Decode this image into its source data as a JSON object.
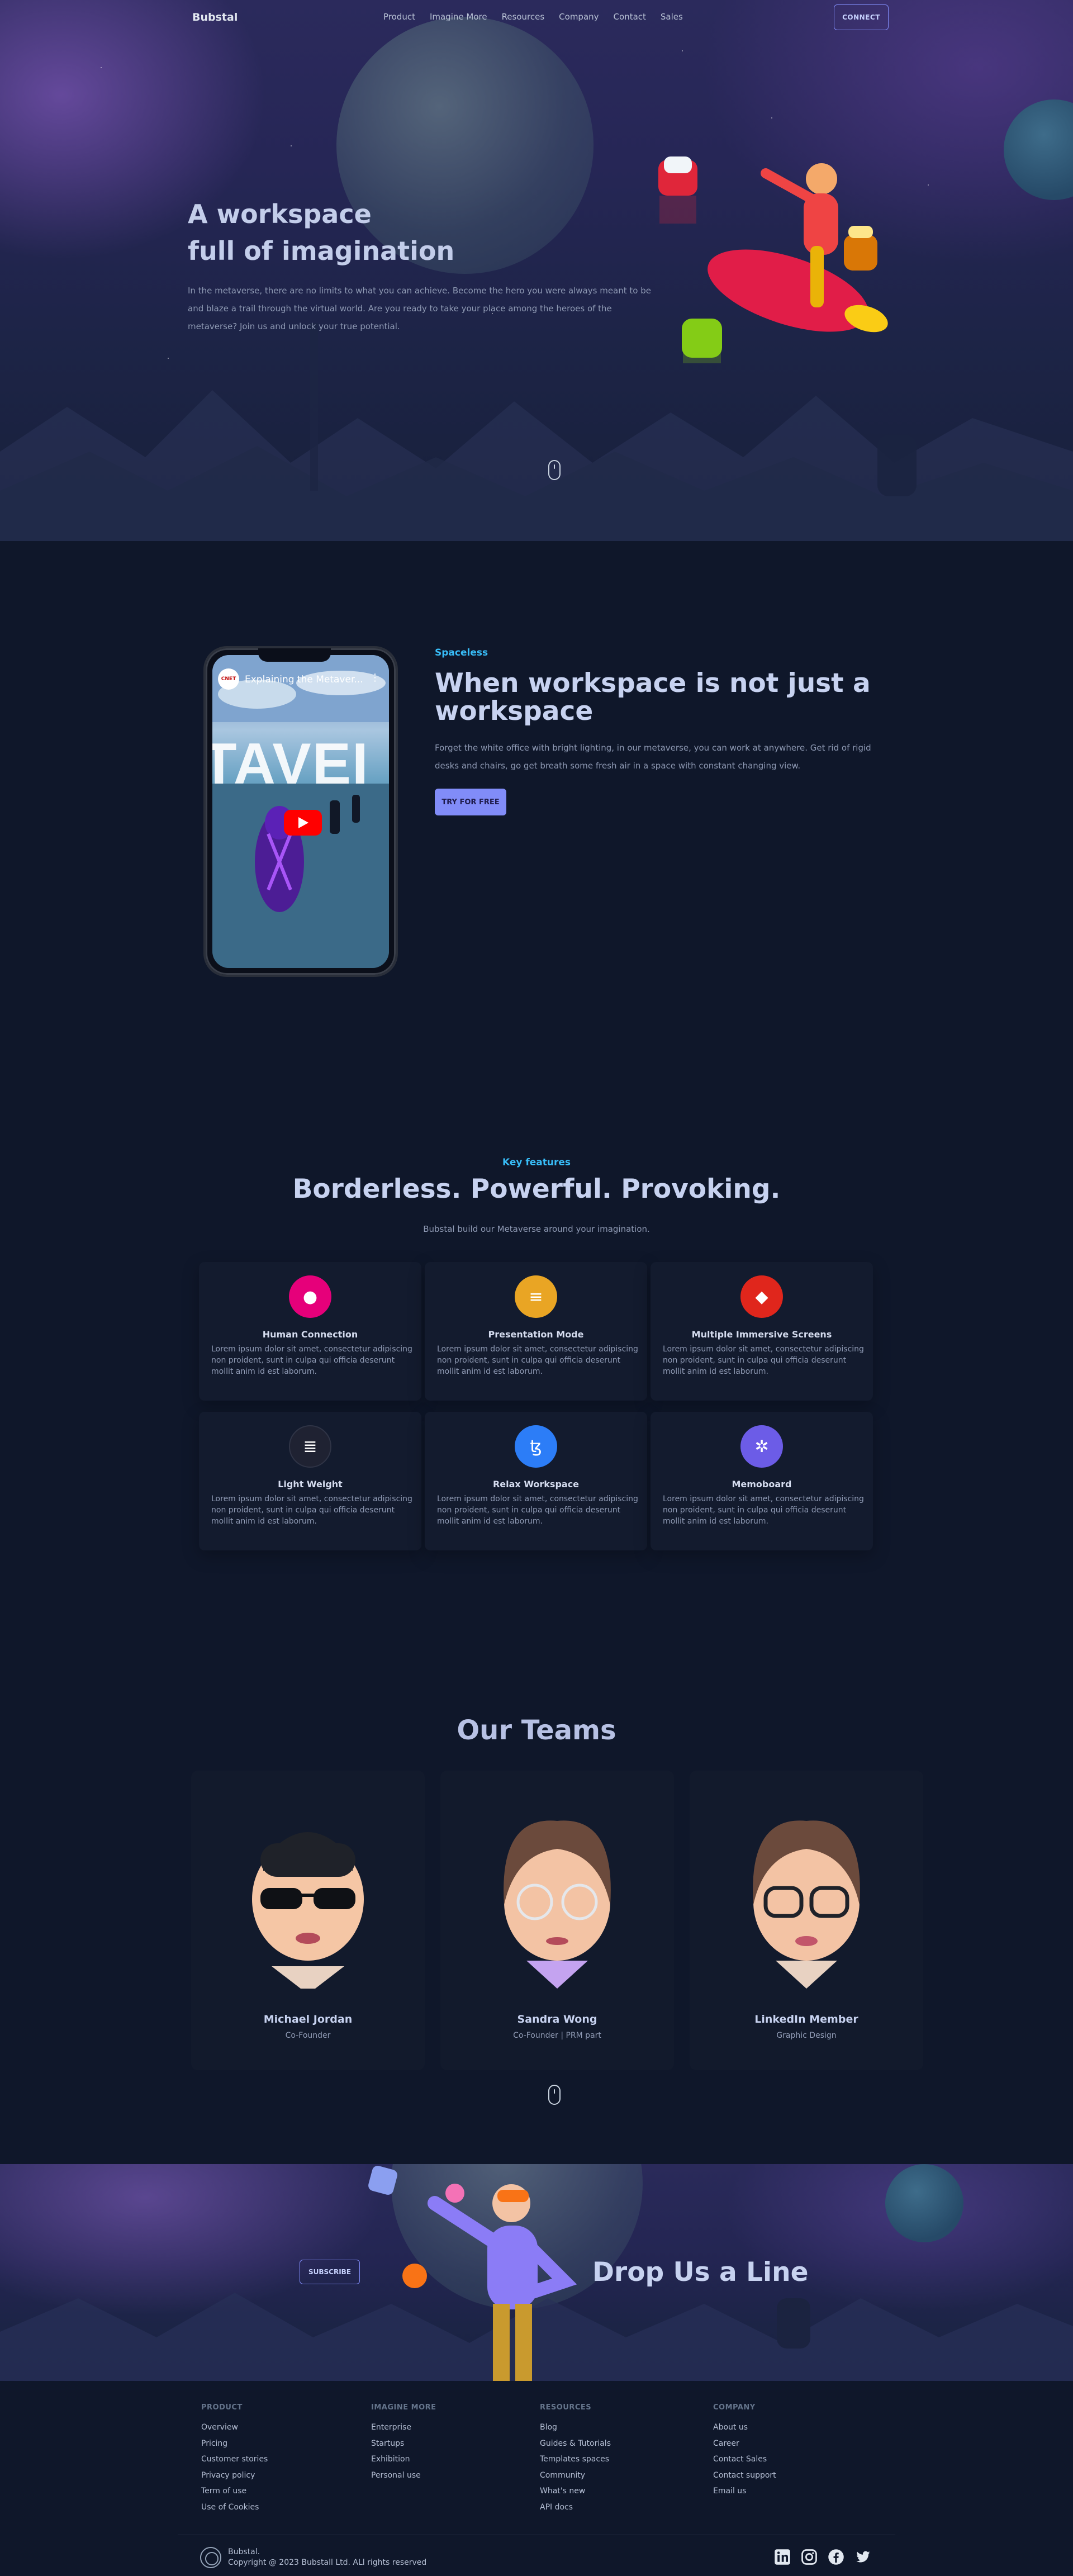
{
  "nav": {
    "brand": "Bubstal",
    "links": [
      "Product",
      "Imagine More",
      "Resources",
      "Company",
      "Contact",
      "Sales"
    ],
    "connect_label": "CONNECT"
  },
  "hero": {
    "title_line1": "A workspace",
    "title_line2": "full of imagination",
    "description": "In the metaverse, there are no limits to what you can achieve. Become the hero you were always meant to be and blaze a trail through the virtual world. Are you ready to take your place among the heroes of the metaverse? Join us and unlock your true potential."
  },
  "video": {
    "channel_logo": "CNET",
    "title": "Explaining the Metaver...",
    "overlay_text": "TAVEI"
  },
  "spaceless": {
    "eyebrow": "Spaceless",
    "title": "When workspace is not just a workspace",
    "description": "Forget the white office with bright lighting, in our metaverse, you can work at anywhere. Get rid of rigid desks and chairs, go get breath some fresh air in a space with constant changing view.",
    "cta_label": "TRY FOR FREE"
  },
  "features": {
    "eyebrow": "Key features",
    "title": "Borderless. Powerful. Provoking.",
    "subtitle": "Bubstal build our Metaverse around your imagination.",
    "items": [
      {
        "title": "Human Connection",
        "description": "Lorem ipsum dolor sit amet, consectetur adipiscing non proident, sunt in culpa qui officia deserunt mollit anim id est laborum.",
        "icon": "polkadot-icon",
        "color": "#e6007a",
        "glyph": "●"
      },
      {
        "title": "Presentation Mode",
        "description": "Lorem ipsum dolor sit amet, consectetur adipiscing non proident, sunt in culpa qui officia deserunt mollit anim id est laborum.",
        "icon": "stacks-icon",
        "color": "#e9a524",
        "glyph": "≡"
      },
      {
        "title": "Multiple Immersive Screens",
        "description": "Lorem ipsum dolor sit amet, consectetur adipiscing non proident, sunt in culpa qui officia deserunt mollit anim id est laborum.",
        "icon": "shiba-icon",
        "color": "#e0261c",
        "glyph": "◆"
      },
      {
        "title": "Light Weight",
        "description": "Lorem ipsum dolor sit amet, consectetur adipiscing non proident, sunt in culpa qui officia deserunt mollit anim id est laborum.",
        "icon": "solana-icon",
        "color": "#1f2232",
        "glyph": "≣"
      },
      {
        "title": "Relax Workspace",
        "description": "Lorem ipsum dolor sit amet, consectetur adipiscing non proident, sunt in culpa qui officia deserunt mollit anim id est laborum.",
        "icon": "tezos-icon",
        "color": "#2c7df7",
        "glyph": "ꜩ"
      },
      {
        "title": "Memoboard",
        "description": "Lorem ipsum dolor sit amet, consectetur adipiscing non proident, sunt in culpa qui officia deserunt mollit anim id est laborum.",
        "icon": "stellar-icon",
        "color": "#6c5ce7",
        "glyph": "✲"
      }
    ]
  },
  "teams": {
    "title": "Our Teams",
    "members": [
      {
        "name": "Michael Jordan",
        "role": "Co-Founder"
      },
      {
        "name": "Sandra Wong",
        "role": "Co-Founder | PRM part"
      },
      {
        "name": "LinkedIn Member",
        "role": "Graphic Design"
      }
    ]
  },
  "cta": {
    "subscribe_label": "SUBSCRIBE",
    "title": "Drop Us a Line"
  },
  "footer": {
    "columns": [
      {
        "heading": "PRODUCT",
        "items": [
          "Overview",
          "Pricing",
          "Customer stories",
          "Privacy policy",
          "Term of use",
          "Use of Cookies"
        ]
      },
      {
        "heading": "IMAGINE MORE",
        "items": [
          "Enterprise",
          "Startups",
          "Exhibition",
          "Personal use"
        ]
      },
      {
        "heading": "RESOURCES",
        "items": [
          "Blog",
          "Guides & Tutorials",
          "Templates spaces",
          "Community",
          "What's new",
          "API docs"
        ]
      },
      {
        "heading": "COMPANY",
        "items": [
          "About us",
          "Career",
          "Contact Sales",
          "Contact support",
          "Email us"
        ]
      }
    ],
    "brand": "Bubstal.",
    "copyright": "Copyright @ 2023 Bubstall Ltd. ALl rights reserved",
    "socials": [
      "linkedin-icon",
      "instagram-icon",
      "facebook-icon",
      "twitter-icon"
    ]
  }
}
